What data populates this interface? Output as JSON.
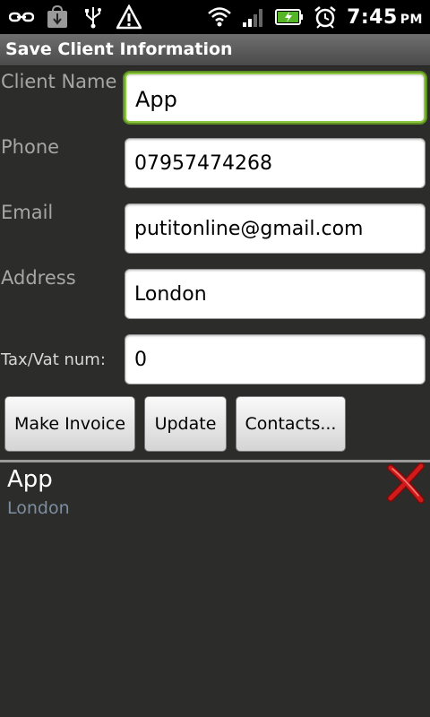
{
  "status_bar": {
    "time": "7:45",
    "ampm": "PM",
    "icons_left": [
      "link-icon",
      "download-icon",
      "usb-icon",
      "warning-icon"
    ],
    "icons_right": [
      "wifi-icon",
      "signal-icon",
      "battery-icon",
      "alarm-icon"
    ]
  },
  "title": "Save Client Information",
  "form": {
    "client_name": {
      "label": "Client Name",
      "value": "App"
    },
    "phone": {
      "label": "Phone",
      "value": "07957474268"
    },
    "email": {
      "label": "Email",
      "value": "putitonline@gmail.com"
    },
    "address": {
      "label": "Address",
      "value": "London"
    },
    "tax": {
      "label": "Tax/Vat num:",
      "value": "0"
    }
  },
  "buttons": {
    "make_invoice": "Make Invoice",
    "update": "Update",
    "contacts": "Contacts..."
  },
  "clients": [
    {
      "name": "App",
      "address": "London"
    }
  ],
  "colors": {
    "background": "#2c2d2b",
    "focus_border": "#8cc63f",
    "secondary_text": "#7d8ea0",
    "delete_red": "#d11a1a"
  }
}
